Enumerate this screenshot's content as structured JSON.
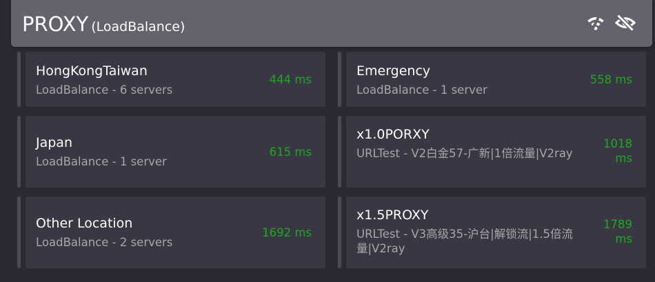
{
  "header": {
    "title": "PROXY",
    "mode": "(LoadBalance)",
    "icons": [
      "wifi-off-icon",
      "eye-off-icon"
    ]
  },
  "proxies": [
    {
      "name": "HongKongTaiwan",
      "desc": "LoadBalance - 6 servers",
      "latency": "444 ms"
    },
    {
      "name": "Emergency",
      "desc": "LoadBalance - 1 server",
      "latency": "558 ms"
    },
    {
      "name": "Japan",
      "desc": "LoadBalance - 1 server",
      "latency": "615 ms"
    },
    {
      "name": "x1.0PORXY",
      "desc": "URLTest - V2白金57-广新|1倍流量|V2ray",
      "latency": "1018 ms"
    },
    {
      "name": "Other Location",
      "desc": "LoadBalance - 2 servers",
      "latency": "1692 ms"
    },
    {
      "name": "x1.5PROXY",
      "desc": "URLTest - V3高级35-沪台|解锁流|1.5倍流量|V2ray",
      "latency": "1789 ms"
    }
  ],
  "colors": {
    "background": "#2b2a33",
    "header": "#63636c",
    "card": "#383743",
    "latency": "#1fa91f",
    "desc": "#a7a6ae"
  }
}
